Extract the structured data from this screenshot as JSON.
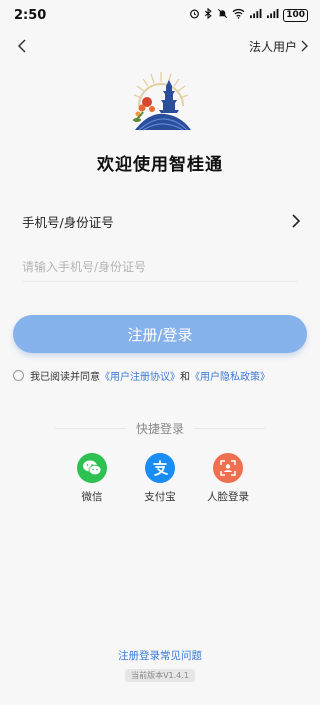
{
  "status_bar": {
    "time": "2:50",
    "icons": [
      "alarm-icon",
      "bluetooth-icon",
      "mute-icon",
      "wifi-icon",
      "signal-icon",
      "signal-icon"
    ],
    "battery": "100"
  },
  "nav": {
    "back_icon": "chevron-left-icon",
    "legal_user_label": "法人用户"
  },
  "welcome_text": "欢迎使用智桂通",
  "id_selector": {
    "label": "手机号/身份证号"
  },
  "id_input": {
    "placeholder": "请输入手机号/身份证号",
    "value": ""
  },
  "submit_label": "注册/登录",
  "agreement": {
    "prefix": "我已阅读并同意",
    "link1": "《用户注册协议》",
    "and": "和",
    "link2": "《用户隐私政策》"
  },
  "quick_login": {
    "title": "快捷登录",
    "items": [
      {
        "label": "微信",
        "icon": "wechat-icon",
        "color": "#2dc152"
      },
      {
        "label": "支付宝",
        "icon": "alipay-icon",
        "color": "#1a8cf5"
      },
      {
        "label": "人脸登录",
        "icon": "face-scan-icon",
        "color": "#ef6f4f"
      }
    ]
  },
  "faq_label": "注册登录常见问题",
  "version_label": "当前版本V1.4.1",
  "colors": {
    "accent": "#86b2ec",
    "link": "#3d7ad6"
  }
}
